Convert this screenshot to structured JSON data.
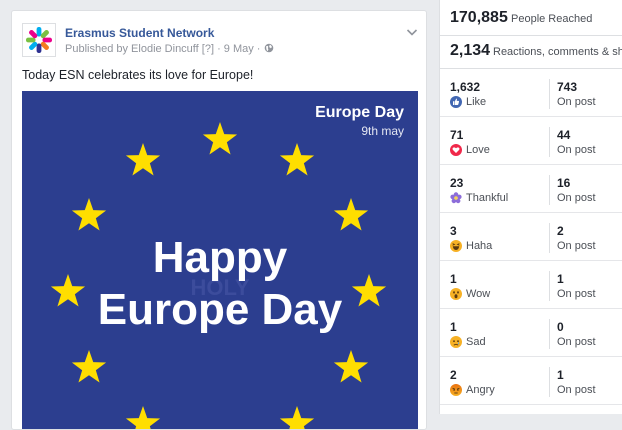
{
  "post": {
    "page_name": "Erasmus Student Network",
    "published_by_prefix": "Published by ",
    "author": "Elodie Dincuff",
    "author_suffix": " [?]",
    "date": " · 9 May · ",
    "text": "Today ESN celebrates its love for Europe!",
    "image": {
      "corner_title": "Europe Day",
      "corner_date": "9th may",
      "headline_1": "Happy",
      "headline_2": "Europe Day",
      "watermark": "HOLY",
      "background_color": "#2c3e8f",
      "star_color": "#ffde00"
    }
  },
  "insights": {
    "people_reached": "170,885",
    "people_reached_label": "People Reached",
    "engagements": "2,134",
    "engagements_label": "Reactions, comments & shar",
    "reactions": [
      {
        "name": "Like",
        "count": "1,632",
        "on_post": "743",
        "on_post_label": "On post",
        "icon": "like-icon",
        "color": "#4267b2"
      },
      {
        "name": "Love",
        "count": "71",
        "on_post": "44",
        "on_post_label": "On post",
        "icon": "love-icon",
        "color": "#f0284a"
      },
      {
        "name": "Thankful",
        "count": "23",
        "on_post": "16",
        "on_post_label": "On post",
        "icon": "thankful-icon",
        "color": "#8c6cd9"
      },
      {
        "name": "Haha",
        "count": "3",
        "on_post": "2",
        "on_post_label": "On post",
        "icon": "haha-icon",
        "color": "#f7b125"
      },
      {
        "name": "Wow",
        "count": "1",
        "on_post": "1",
        "on_post_label": "On post",
        "icon": "wow-icon",
        "color": "#f7b125"
      },
      {
        "name": "Sad",
        "count": "1",
        "on_post": "0",
        "on_post_label": "On post",
        "icon": "sad-icon",
        "color": "#f7b125"
      },
      {
        "name": "Angry",
        "count": "2",
        "on_post": "1",
        "on_post_label": "On post",
        "icon": "angry-icon",
        "color": "#e9710f"
      }
    ]
  }
}
